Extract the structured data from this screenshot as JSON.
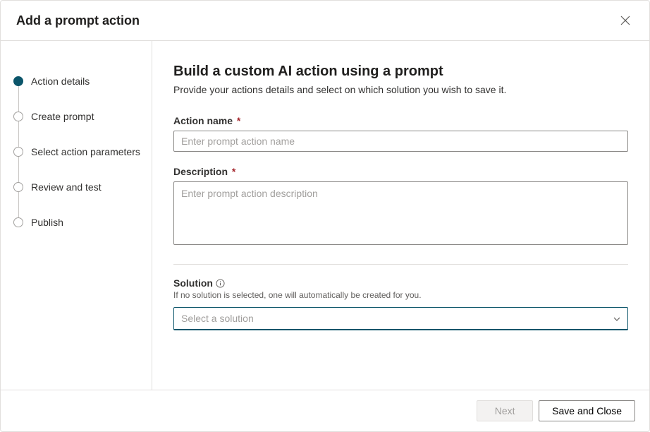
{
  "header": {
    "title": "Add a prompt action"
  },
  "sidebar": {
    "steps": [
      {
        "label": "Action details",
        "active": true
      },
      {
        "label": "Create prompt",
        "active": false
      },
      {
        "label": "Select action parameters",
        "active": false
      },
      {
        "label": "Review and test",
        "active": false
      },
      {
        "label": "Publish",
        "active": false
      }
    ]
  },
  "content": {
    "title": "Build a custom AI action using a prompt",
    "subtitle": "Provide your actions details and select on which solution you wish to save it.",
    "action_name_label": "Action name",
    "action_name_placeholder": "Enter prompt action name",
    "action_name_value": "",
    "description_label": "Description",
    "description_placeholder": "Enter prompt action description",
    "description_value": "",
    "solution_label": "Solution",
    "solution_hint": "If no solution is selected, one will automatically be created for you.",
    "solution_placeholder": "Select a solution"
  },
  "footer": {
    "next_label": "Next",
    "save_close_label": "Save and Close"
  },
  "required_marker": "*"
}
